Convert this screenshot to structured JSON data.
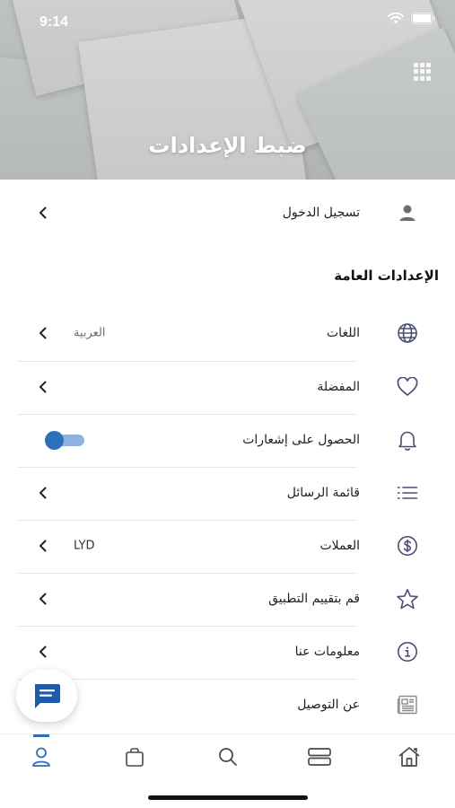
{
  "status_bar": {
    "time": "9:14"
  },
  "header": {
    "title": "ضبط الإعدادات"
  },
  "login": {
    "label": "تسجيل الدخول"
  },
  "general_section": {
    "title": "الإعدادات العامة",
    "items": [
      {
        "key": "languages",
        "label": "اللغات",
        "value": "العربية",
        "icon": "globe-icon"
      },
      {
        "key": "favorites",
        "label": "المفضلة",
        "value": "",
        "icon": "heart-icon"
      },
      {
        "key": "notifications",
        "label": "الحصول على إشعارات",
        "value": "",
        "icon": "bell-icon",
        "toggle_on": true
      },
      {
        "key": "messages",
        "label": "قائمة الرسائل",
        "value": "",
        "icon": "list-icon"
      },
      {
        "key": "currencies",
        "label": "العملات",
        "value": "LYD",
        "icon": "dollar-icon"
      },
      {
        "key": "rate",
        "label": "قم بتقييم التطبيق",
        "value": "",
        "icon": "star-icon"
      },
      {
        "key": "about",
        "label": "معلومات عنا",
        "value": "",
        "icon": "info-icon"
      },
      {
        "key": "delivery",
        "label": "عن التوصيل",
        "value": "",
        "icon": "newspaper-icon"
      }
    ]
  },
  "colors": {
    "accent": "#2d6fb8",
    "toggle_track": "#8fb3df"
  },
  "bottom_nav": [
    {
      "name": "profile",
      "icon": "user-icon",
      "active": true
    },
    {
      "name": "cart",
      "icon": "bag-icon",
      "active": false
    },
    {
      "name": "search",
      "icon": "search-icon",
      "active": false
    },
    {
      "name": "categories",
      "icon": "layers-icon",
      "active": false
    },
    {
      "name": "home",
      "icon": "home-icon",
      "active": false
    }
  ]
}
